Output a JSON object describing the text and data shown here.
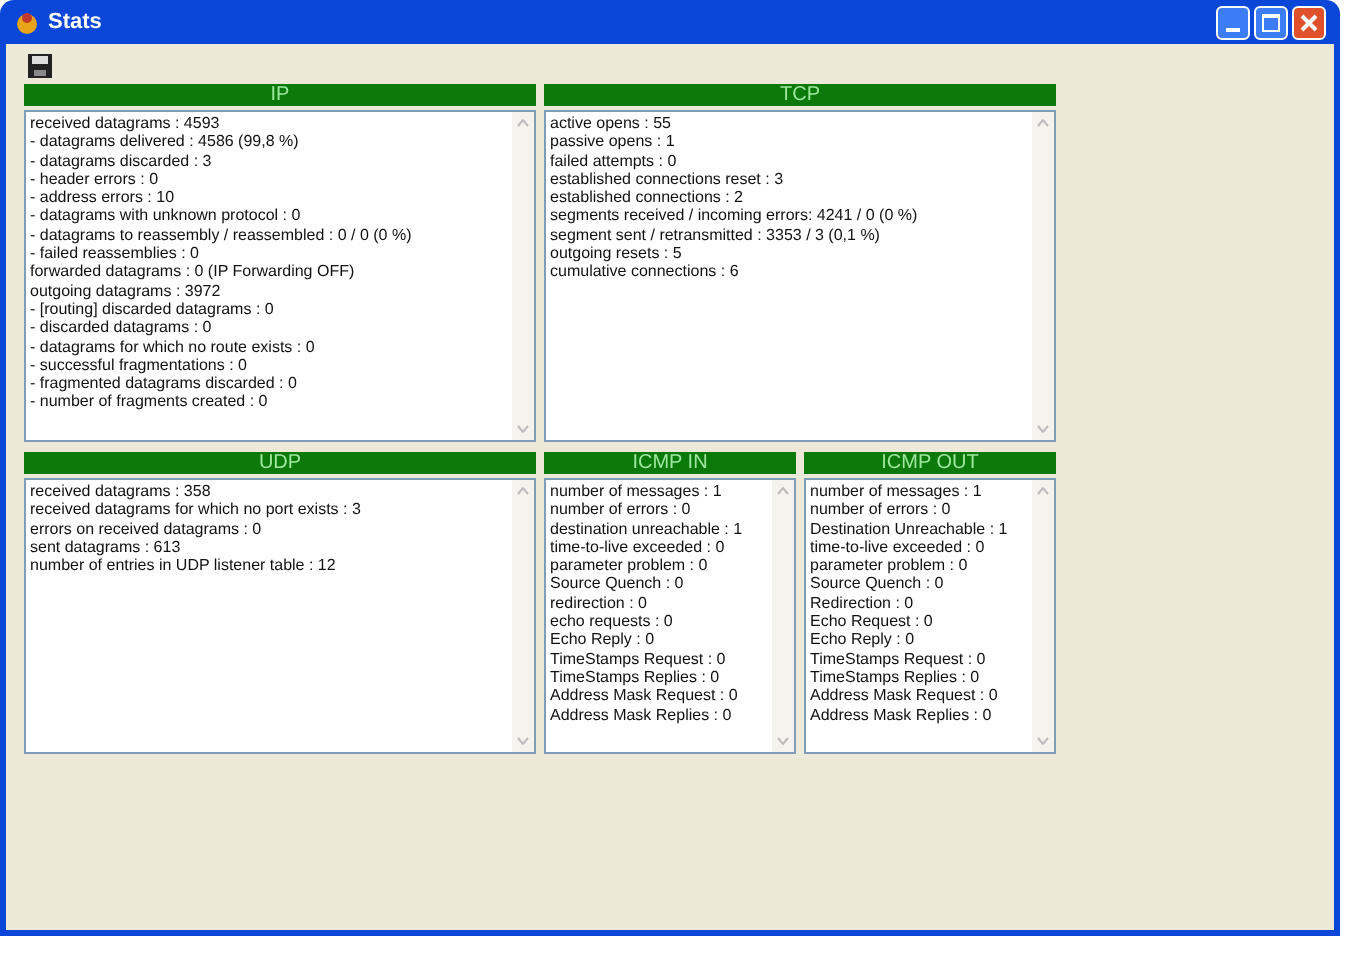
{
  "window": {
    "title": "Stats"
  },
  "panels": [
    {
      "title": "IP",
      "lines": [
        "received datagrams : 4593",
        "- datagrams delivered : 4586 (99,8 %)",
        "- datagrams discarded : 3",
        "- header errors : 0",
        "- address errors : 10",
        "- datagrams with unknown protocol : 0",
        "- datagrams to reassembly / reassembled : 0 / 0 (0 %)",
        "- failed reassemblies : 0",
        "forwarded datagrams : 0 (IP Forwarding OFF)",
        "outgoing datagrams : 3972",
        "- [routing] discarded datagrams : 0",
        "- discarded datagrams : 0",
        "- datagrams for which no route exists : 0",
        "- successful fragmentations : 0",
        "- fragmented datagrams discarded : 0",
        "- number of fragments created : 0"
      ]
    },
    {
      "title": "TCP",
      "lines": [
        "active opens : 55",
        "passive opens : 1",
        "failed attempts : 0",
        "established connections reset : 3",
        "established connections : 2",
        "segments received  / incoming errors: 4241 / 0 (0 %)",
        "segment sent / retransmitted : 3353 / 3 (0,1 %)",
        "outgoing resets : 5",
        "cumulative connections : 6"
      ]
    },
    {
      "title": "UDP",
      "lines": [
        "received datagrams : 358",
        "received datagrams for which no port exists : 3",
        "errors on received datagrams : 0",
        "sent datagrams : 613",
        "number of entries in UDP listener table : 12"
      ]
    },
    {
      "title": "ICMP IN",
      "lines": [
        "number of messages : 1",
        "number of errors : 0",
        "destination unreachable : 1",
        "time-to-live exceeded : 0",
        "parameter problem : 0",
        "Source Quench : 0",
        "redirection : 0",
        "echo requests : 0",
        "Echo Reply : 0",
        "TimeStamps Request : 0",
        "TimeStamps Replies : 0",
        "Address Mask Request : 0",
        "Address Mask Replies : 0"
      ]
    },
    {
      "title": "ICMP OUT",
      "lines": [
        "number of messages : 1",
        "number of errors : 0",
        "Destination Unreachable : 1",
        "time-to-live exceeded : 0",
        "parameter problem : 0",
        "Source Quench : 0",
        "Redirection : 0",
        "Echo Request : 0",
        "Echo Reply : 0",
        "TimeStamps Request : 0",
        "TimeStamps Replies : 0",
        "Address Mask Request : 0",
        "Address Mask Replies : 0"
      ]
    }
  ]
}
